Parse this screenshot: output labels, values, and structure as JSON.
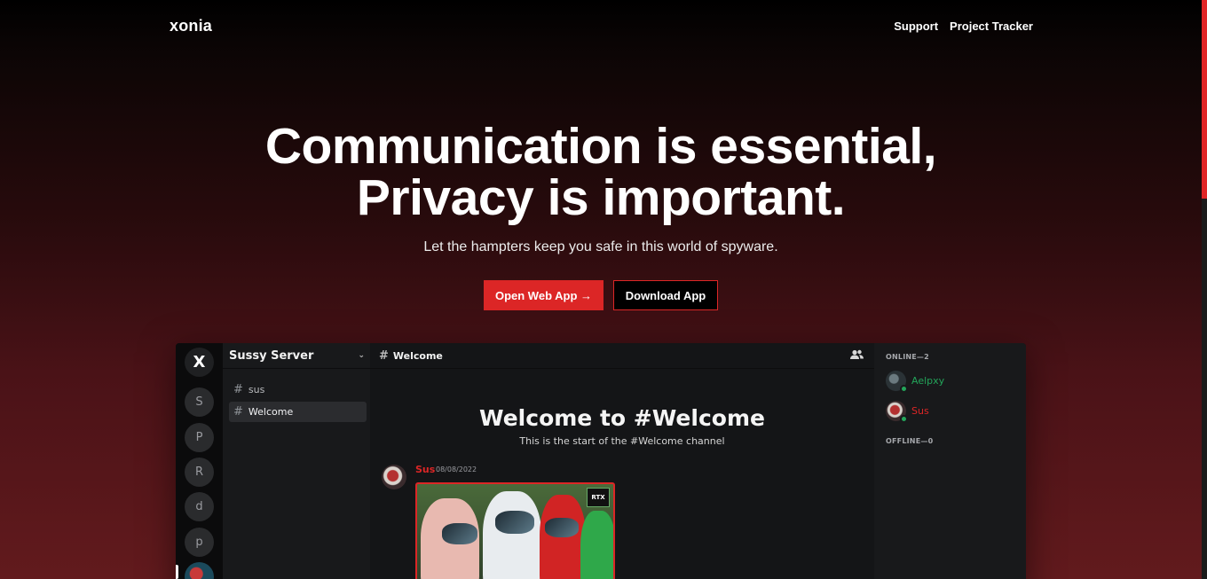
{
  "nav": {
    "brand": "xonia",
    "links": [
      "Support",
      "Project Tracker"
    ]
  },
  "hero": {
    "title_line1": "Communication is essential,",
    "title_line2": "Privacy is important.",
    "subtitle": "Let the hampters keep you safe in this world of spyware.",
    "primary_button": "Open Web App →",
    "secondary_button": "Download App"
  },
  "app_preview": {
    "server_rail": {
      "home_label": "X",
      "servers": [
        "S",
        "P",
        "R",
        "d",
        "p"
      ]
    },
    "server_name": "Sussy Server",
    "channels": [
      {
        "name": "sus",
        "active": false
      },
      {
        "name": "Welcome",
        "active": true
      }
    ],
    "chat": {
      "channel_name": "Welcome",
      "welcome_title": "Welcome to #Welcome",
      "welcome_subtitle": "This is the start of the #Welcome channel",
      "message": {
        "author": "Sus",
        "timestamp": "08/08/2022"
      }
    },
    "members": {
      "online_header": "ONLINE—2",
      "offline_header": "OFFLINE—0",
      "online": [
        {
          "name": "Aelpxy",
          "color": "#23a55a"
        },
        {
          "name": "Sus",
          "color": "#dc2626"
        }
      ]
    }
  },
  "colors": {
    "accent": "#dc2626",
    "online": "#23a55a"
  }
}
